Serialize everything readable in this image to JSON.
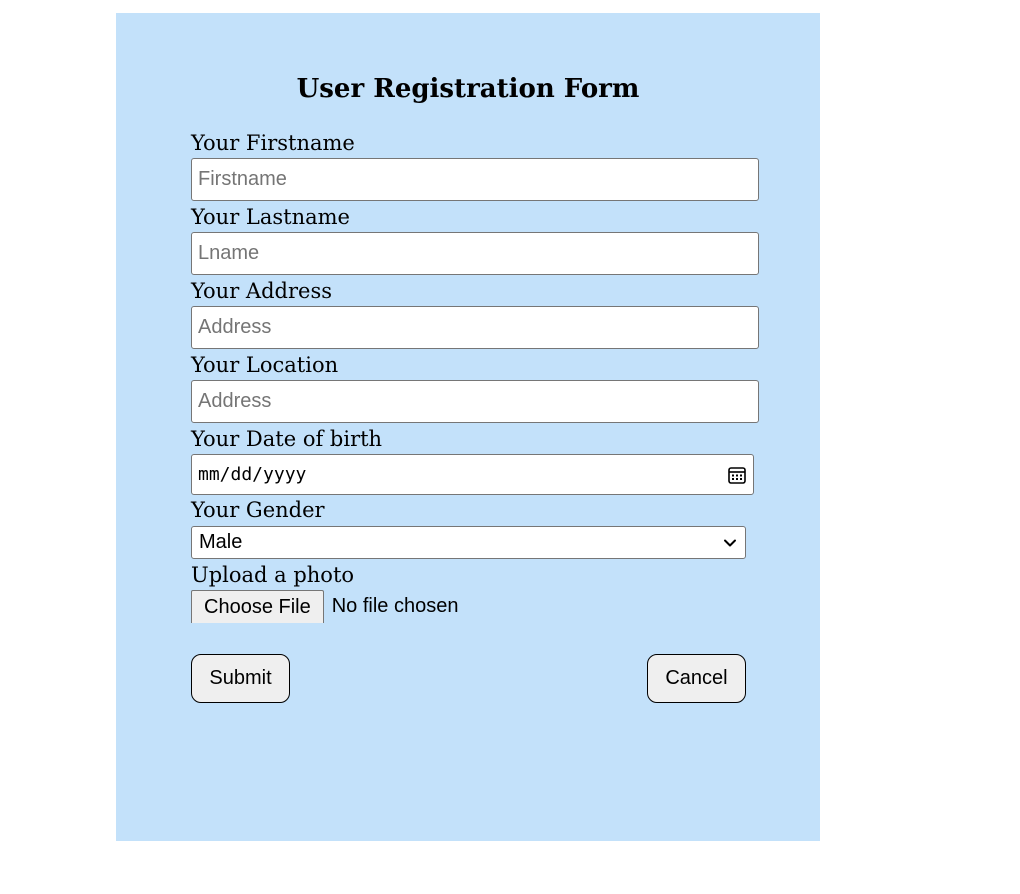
{
  "form": {
    "title": "User Registration Form",
    "firstname": {
      "label": "Your Firstname",
      "placeholder": "Firstname",
      "value": ""
    },
    "lastname": {
      "label": "Your Lastname",
      "placeholder": "Lname",
      "value": ""
    },
    "address": {
      "label": "Your Address",
      "placeholder": "Address",
      "value": ""
    },
    "location": {
      "label": "Your Location",
      "placeholder": "Address",
      "value": ""
    },
    "dob": {
      "label": "Your Date of birth",
      "placeholder": "mm/dd/yyyy"
    },
    "gender": {
      "label": "Your Gender",
      "selected": "Male"
    },
    "photo": {
      "label": "Upload a photo",
      "button_label": "Choose File",
      "status": "No file chosen"
    },
    "submit_label": "Submit",
    "cancel_label": "Cancel"
  },
  "icons": {
    "calendar": "calendar-icon",
    "dropdown": "chevron-down-icon"
  },
  "colors": {
    "panel_background": "#c3e1fa",
    "page_background": "#ffffff",
    "button_background": "#efefef",
    "input_border": "#767676"
  }
}
